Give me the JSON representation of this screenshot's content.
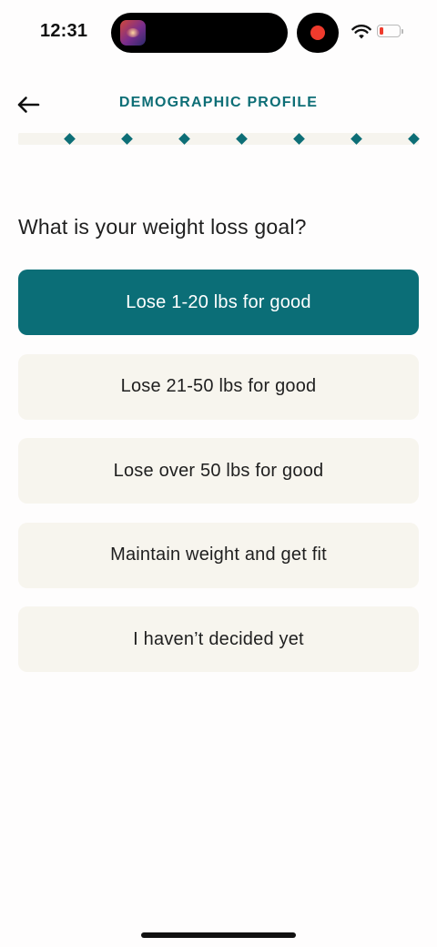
{
  "status_bar": {
    "time": "12:31",
    "recording_color": "#ef3b2d",
    "battery_level_color": "#ef3b2d"
  },
  "header": {
    "title": "DEMOGRAPHIC PROFILE",
    "back_icon": "arrow-left-icon"
  },
  "progress": {
    "steps": 7,
    "accent": "#0d6e76"
  },
  "question": {
    "text": "What is your weight loss goal?"
  },
  "options": [
    {
      "label": "Lose 1-20 lbs for good",
      "selected": true
    },
    {
      "label": "Lose 21-50 lbs for good",
      "selected": false
    },
    {
      "label": "Lose over 50 lbs for good",
      "selected": false
    },
    {
      "label": "Maintain weight and get fit",
      "selected": false
    },
    {
      "label": "I haven’t decided yet",
      "selected": false
    }
  ],
  "colors": {
    "brand": "#0d6e76",
    "selected_bg": "#0b6e77",
    "option_bg": "#f7f5ee",
    "page_bg": "#fefdfd"
  }
}
